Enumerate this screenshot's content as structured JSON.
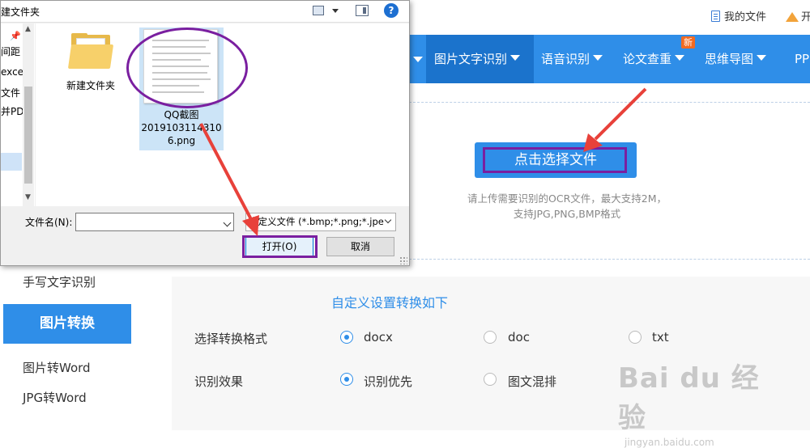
{
  "colors": {
    "primary_blue": "#2f8ee8",
    "nav_active": "#1b73cc",
    "annotation_purple": "#7a1fa0",
    "arrow_red": "#e8413a",
    "badge_orange": "#f26a21"
  },
  "topbar": {
    "my_docs": "我的文件",
    "vip_label": "开"
  },
  "nav": {
    "items": [
      {
        "label": "图片文字识别",
        "icon": "caret-down"
      },
      {
        "label": "语音识别",
        "icon": "caret-down"
      },
      {
        "label": "论文查重",
        "icon": "caret-down",
        "badge": "新"
      },
      {
        "label": "思维导图",
        "icon": "caret-down"
      },
      {
        "label": "PP"
      }
    ]
  },
  "upload": {
    "button_label": "点击选择文件",
    "hint_line1": "请上传需要识别的OCR文件，最大支持2M，",
    "hint_line2": "支持JPG,PNG,BMP格式"
  },
  "sidebar": {
    "item_handwriting": "手写文字识别",
    "section_active": "图片转换",
    "item_img_word": "图片转Word",
    "item_jpg_word": "JPG转Word"
  },
  "settings": {
    "title": "自定义设置转换如下",
    "format_label": "选择转换格式",
    "format_options": [
      "docx",
      "doc",
      "txt"
    ],
    "format_selected": "docx",
    "effect_label": "识别效果",
    "effect_options": [
      "识别优先",
      "图文混排"
    ],
    "effect_selected": "识别优先"
  },
  "watermark": {
    "logo": "Bai du 经验",
    "url": "jingyan.baidu.com"
  },
  "dialog": {
    "toolbar_new_folder": "建文件夹",
    "nav_items": [
      "间距",
      "excel",
      "文件",
      "并PD"
    ],
    "files": [
      {
        "name": "新建文件夹",
        "type": "folder"
      },
      {
        "name_line1": "QQ截图",
        "name_line2": "2019103114310",
        "name_line3": "6.png",
        "type": "image"
      }
    ],
    "filename_label": "文件名(N):",
    "filename_value": "",
    "filter_value": "自定义文件 (*.bmp;*.png;*.jpe",
    "open_button": "打开(O)",
    "cancel_button": "取消"
  }
}
